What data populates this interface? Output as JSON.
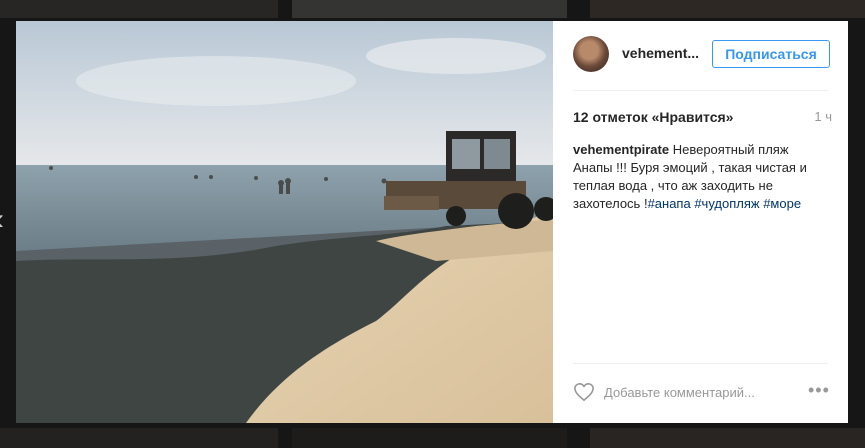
{
  "post": {
    "username": "vehement...",
    "follow_label": "Подписаться",
    "likes": "12 отметок «Нравится»",
    "time": "1 ч",
    "caption": {
      "author": "vehementpirate",
      "text": "Невероятный пляж Анапы !!! Буря эмоций , такая чистая и теплая вода , что аж заходить не захотелось !",
      "tags": [
        "#анапа",
        "#чудопляж",
        "#море"
      ]
    },
    "comment_placeholder": "Добавьте комментарий...",
    "more_symbol": "•••"
  },
  "nav": {
    "prev_arrow": "‹"
  },
  "icons": {
    "heart": "heart-icon",
    "more": "more-options-icon",
    "nav": "chevron-left-icon"
  },
  "colors": {
    "accent": "#3897f0",
    "hashtag": "#003569",
    "text": "#262626",
    "muted": "#999999"
  }
}
